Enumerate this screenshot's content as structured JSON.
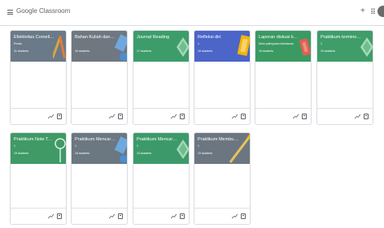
{
  "header": {
    "app_title": "Google Classroom",
    "add_symbol": "+"
  },
  "classes": [
    {
      "title": "Efektivitas Cornell M...",
      "section": "Presis",
      "students": "31 students",
      "color": "#6b7a88"
    },
    {
      "title": "Bahan Kuliah dan Pen...",
      "section": "",
      "students": "16 students",
      "color": "#6f7881"
    },
    {
      "title": "Journal Reading",
      "section": "",
      "students": "17 students",
      "color": "#3c9d6b"
    },
    {
      "title": "Refleksi diri",
      "section": "1",
      "students": "16 students",
      "color": "#4b65c8"
    },
    {
      "title": "Laporan diskusi kelo...",
      "section": "Mutu pelimpaian kebidanan",
      "students": "16 students",
      "color": "#3a9a62"
    },
    {
      "title": "Praktikum terminolo...",
      "section": "1",
      "students": "19 students",
      "color": "#3f9d6a"
    },
    {
      "title": "Praktikum Note Takin...",
      "section": "1",
      "students": "15 students",
      "color": "#3f9a66"
    },
    {
      "title": "Praktikum Mencari U...",
      "section": "1",
      "students": "16 students",
      "color": "#6b7781"
    },
    {
      "title": "Praktikum Mencari Ju...",
      "section": "1",
      "students": "10 students",
      "color": "#3c9a6a"
    },
    {
      "title": "Praktikum Membuat ...",
      "section": "1",
      "students": "10 students",
      "color": "#6c7681"
    }
  ]
}
